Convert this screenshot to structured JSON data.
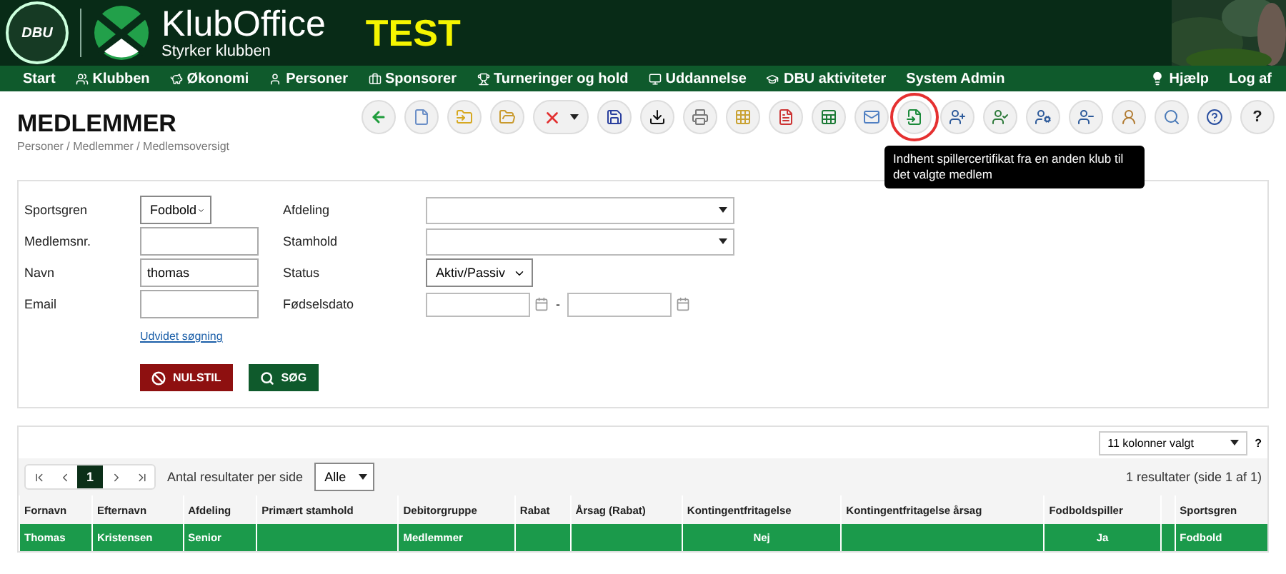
{
  "header": {
    "brand": "KlubOffice",
    "tagline": "Styrker klubben",
    "env_badge": "TEST",
    "seal_text": "DBU"
  },
  "nav": {
    "items": [
      {
        "label": "Start"
      },
      {
        "label": "Klubben"
      },
      {
        "label": "Økonomi"
      },
      {
        "label": "Personer"
      },
      {
        "label": "Sponsorer"
      },
      {
        "label": "Turneringer og hold"
      },
      {
        "label": "Uddannelse"
      },
      {
        "label": "DBU aktiviteter"
      },
      {
        "label": "System Admin"
      }
    ],
    "right": [
      {
        "label": "Hjælp"
      },
      {
        "label": "Log af"
      }
    ]
  },
  "page": {
    "title": "MEDLEMMER",
    "breadcrumb": "Personer / Medlemmer / Medlemsoversigt"
  },
  "toolbar": {
    "buttons": [
      {
        "kind": "icon",
        "highlighted": false
      },
      {
        "kind": "icon",
        "highlighted": false
      },
      {
        "kind": "icon",
        "highlighted": false
      },
      {
        "kind": "icon",
        "highlighted": false
      },
      {
        "kind": "menu",
        "highlighted": false
      },
      {
        "kind": "icon",
        "highlighted": false
      },
      {
        "kind": "icon",
        "highlighted": false
      },
      {
        "kind": "icon",
        "highlighted": false
      },
      {
        "kind": "icon",
        "highlighted": false
      },
      {
        "kind": "icon",
        "highlighted": false
      },
      {
        "kind": "icon",
        "highlighted": false
      },
      {
        "kind": "icon",
        "highlighted": false
      },
      {
        "kind": "icon",
        "highlighted": true
      },
      {
        "kind": "icon",
        "highlighted": false
      },
      {
        "kind": "icon",
        "highlighted": false
      },
      {
        "kind": "icon",
        "highlighted": false
      },
      {
        "kind": "icon",
        "highlighted": false
      },
      {
        "kind": "icon",
        "highlighted": false
      },
      {
        "kind": "icon",
        "highlighted": false
      },
      {
        "kind": "icon",
        "highlighted": false
      },
      {
        "kind": "text",
        "label": "?",
        "highlighted": false
      }
    ],
    "tooltip": "Indhent spillercertifikat fra en anden klub til det valgte medlem"
  },
  "form": {
    "left": [
      {
        "label": "Sportsgren",
        "kind": "select",
        "value": "Fodbold"
      },
      {
        "label": "Medlemsnr.",
        "kind": "input"
      },
      {
        "label": "Navn",
        "kind": "input",
        "value": "thomas"
      },
      {
        "label": "Email",
        "kind": "input"
      }
    ],
    "right": [
      {
        "label": "Afdeling",
        "kind": "combo"
      },
      {
        "label": "Stamhold",
        "kind": "combo"
      },
      {
        "label": "Status",
        "kind": "select",
        "value": "Aktiv/Passiv"
      },
      {
        "label": "Fødselsdato",
        "kind": "daterange",
        "separator": "-"
      }
    ],
    "link": "Udvidet søgning",
    "buttons": [
      {
        "label": "NULSTIL",
        "kind": "reset"
      },
      {
        "label": "SØG",
        "kind": "search"
      }
    ]
  },
  "results": {
    "columns_select": "11 kolonner valgt",
    "help": "?",
    "pages": [
      {
        "label": "1",
        "selected": true
      }
    ],
    "per_page_label": "Antal resultater per side",
    "per_page": "Alle",
    "summary": "1 resultater (side 1 af 1)",
    "columns": [
      {
        "label": "Fornavn",
        "kind": "text"
      },
      {
        "label": "Efternavn",
        "kind": "text"
      },
      {
        "label": "Afdeling",
        "kind": "text"
      },
      {
        "label": "Primært stamhold",
        "kind": "text"
      },
      {
        "label": "Debitorgruppe",
        "kind": "text"
      },
      {
        "label": "Rabat",
        "kind": "text"
      },
      {
        "label": "Årsag (Rabat)",
        "kind": "text"
      },
      {
        "label": "Kontingentfritagelse",
        "kind": "yesno"
      },
      {
        "label": "Kontingentfritagelse årsag",
        "kind": "text"
      },
      {
        "label": "Fodboldspiller",
        "kind": "yesno"
      },
      {
        "kind": "text"
      },
      {
        "label": "Sportsgren",
        "kind": "text"
      }
    ],
    "rows": [
      {
        "selected": true,
        "cells": [
          "Thomas",
          "Kristensen",
          "Senior",
          "",
          "Medlemmer",
          "",
          "",
          "Nej",
          "",
          "Ja",
          "",
          "Fodbold"
        ]
      }
    ]
  }
}
